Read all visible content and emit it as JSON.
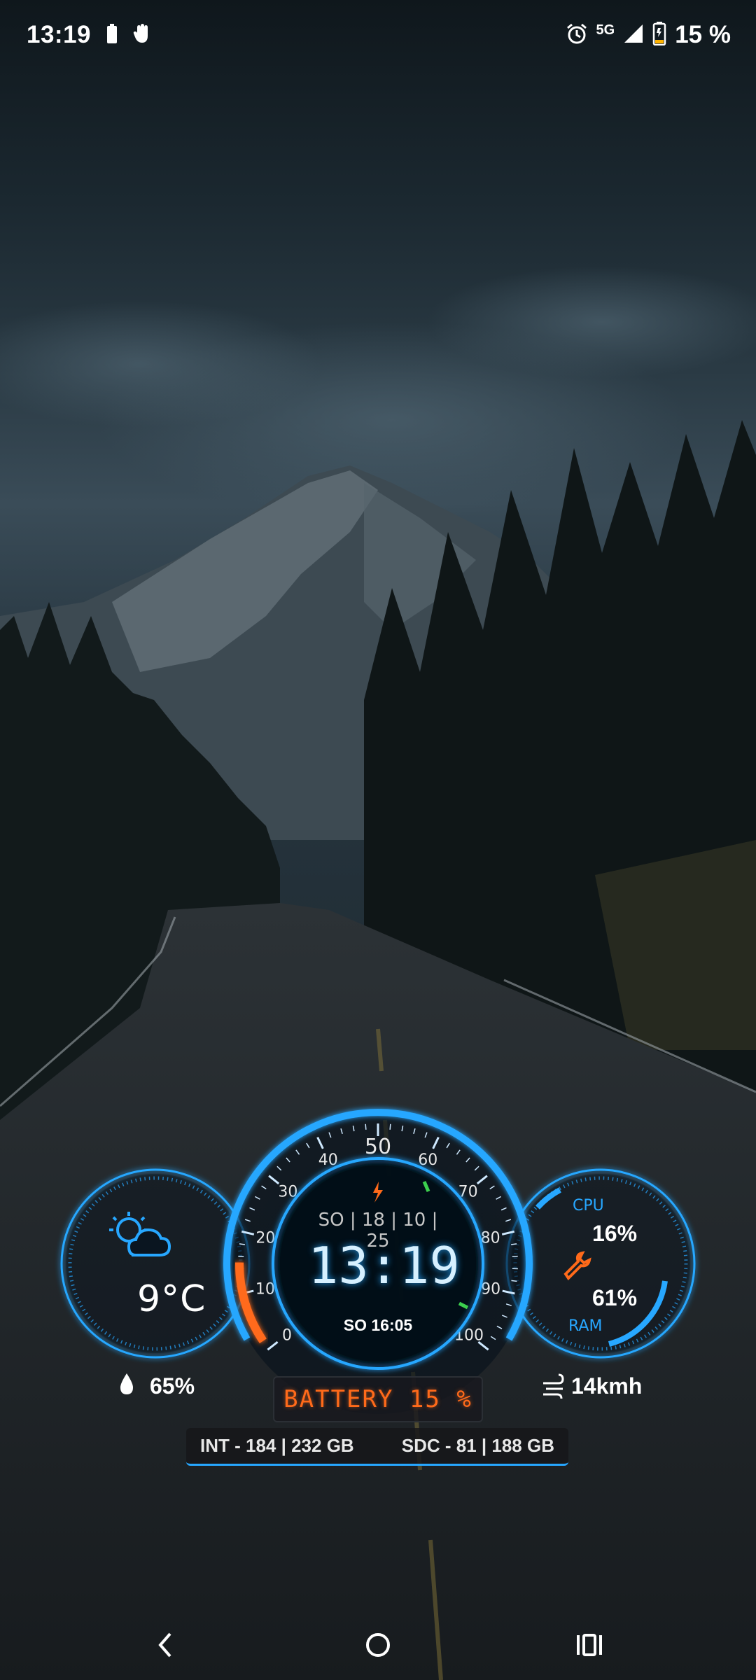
{
  "status_bar": {
    "time": "13:19",
    "network": "5G",
    "battery_percent": "15 %",
    "icons": [
      "battery-icon",
      "gesture-hand-icon",
      "alarm-icon",
      "signal-icon",
      "charging-battery-icon"
    ]
  },
  "widget": {
    "weather": {
      "temperature": "9°C",
      "humidity": "65%",
      "wind": "14kmh",
      "icon": "partly-sunny-icon"
    },
    "gauge": {
      "date": "SO | 18 | 10 | 25",
      "time": "13:19",
      "alarm": "SO 16:05",
      "ticks": [
        "0",
        "10",
        "20",
        "30",
        "40",
        "50",
        "60",
        "70",
        "80",
        "90",
        "100"
      ],
      "battery_level": 15
    },
    "system": {
      "cpu_label": "CPU",
      "cpu_value": "16%",
      "ram_label": "RAM",
      "ram_value": "61%"
    },
    "battery_label": "BATTERY 15 %",
    "storage": {
      "internal": "INT - 184 | 232 GB",
      "sdcard": "SDC - 81 | 188 GB"
    },
    "colors": {
      "accent": "#27a7ff",
      "warning": "#ff6a1a",
      "green": "#3ccf4e"
    }
  },
  "nav_bar": {
    "icons": [
      "back-icon",
      "home-icon",
      "recents-icon"
    ]
  }
}
